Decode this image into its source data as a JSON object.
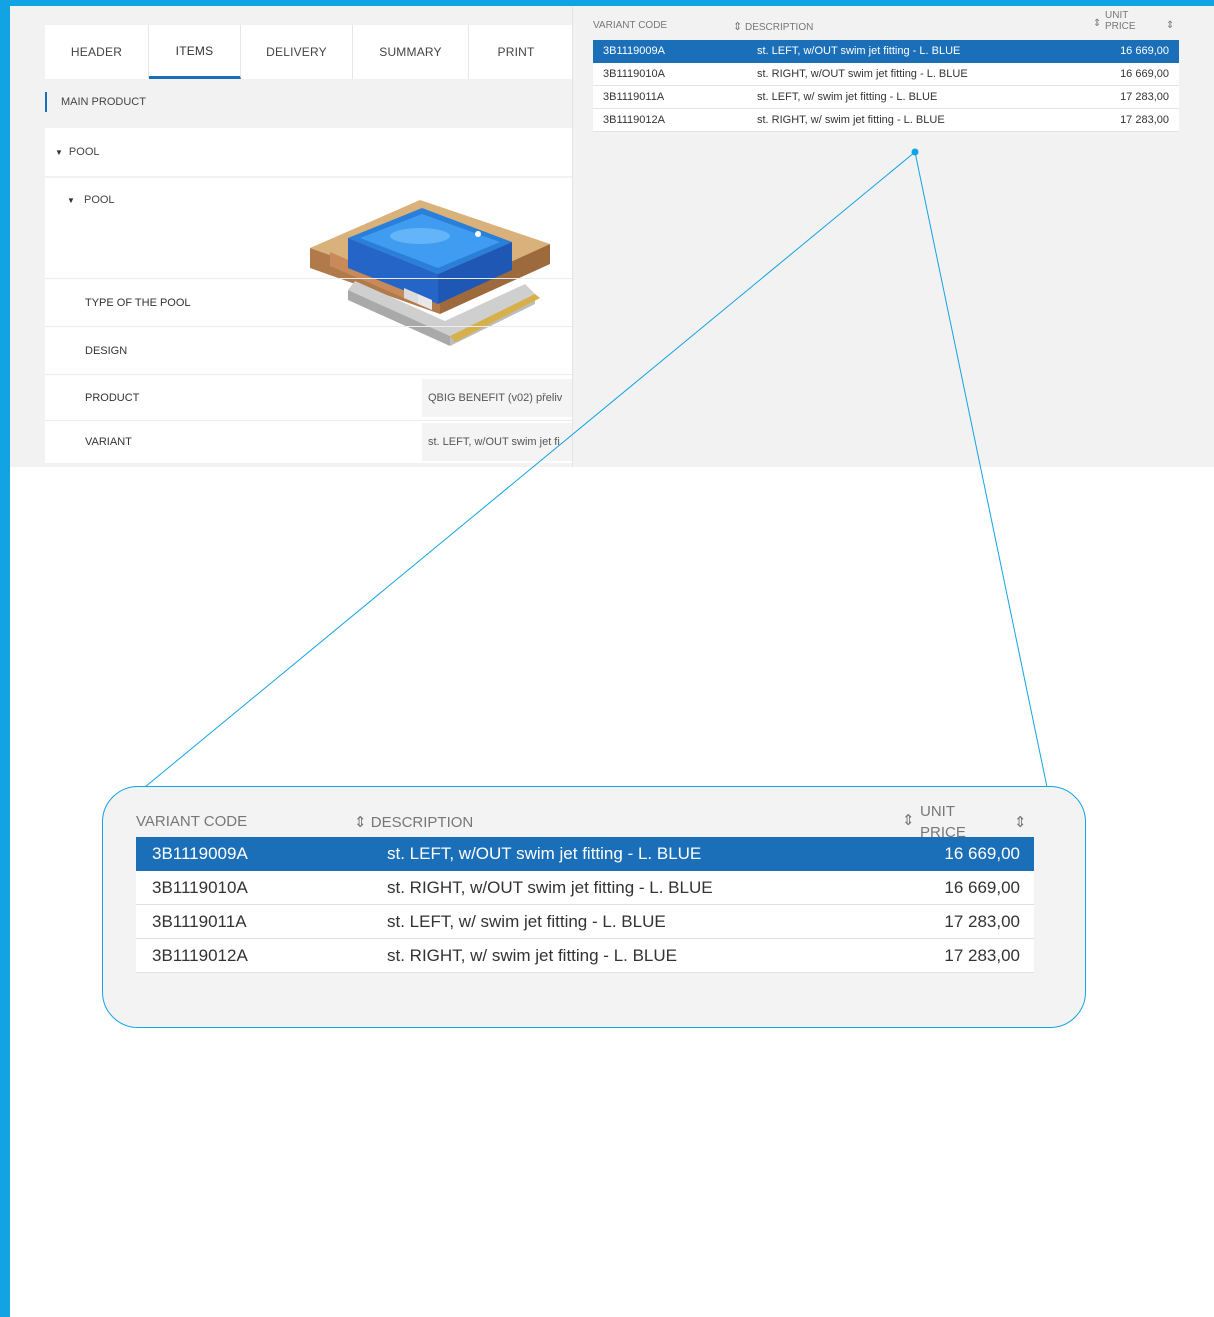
{
  "tabs": [
    {
      "label": "HEADER"
    },
    {
      "label": "ITEMS"
    },
    {
      "label": "DELIVERY"
    },
    {
      "label": "SUMMARY"
    },
    {
      "label": "PRINT"
    }
  ],
  "active_tab": "ITEMS",
  "main_product": {
    "section_label": "MAIN PRODUCT",
    "pool_group_label": "POOL",
    "pool_item_label": "POOL",
    "properties": [
      {
        "label": "TYPE OF THE POOL",
        "value": ""
      },
      {
        "label": "DESIGN",
        "value": ""
      },
      {
        "label": "PRODUCT",
        "value": "QBIG BENEFIT (v02) přeliv"
      },
      {
        "label": "VARIANT",
        "value": "st. LEFT, w/OUT swim jet fi"
      }
    ]
  },
  "variant_table": {
    "columns": {
      "code": "VARIANT CODE",
      "description": "DESCRIPTION",
      "price_line1": "UNIT",
      "price_line2": "PRICE"
    },
    "sort_icon": "⇕",
    "rows": [
      {
        "code": "3B1119009A",
        "description": "st. LEFT, w/OUT swim jet fitting - L. BLUE",
        "price": "16 669,00",
        "selected": true
      },
      {
        "code": "3B1119010A",
        "description": "st. RIGHT, w/OUT swim jet fitting - L. BLUE",
        "price": "16 669,00",
        "selected": false
      },
      {
        "code": "3B1119011A",
        "description": "st. LEFT, w/ swim jet fitting - L. BLUE",
        "price": "17 283,00",
        "selected": false
      },
      {
        "code": "3B1119012A",
        "description": "st. RIGHT, w/ swim jet fitting - L. BLUE",
        "price": "17 283,00",
        "selected": false
      }
    ]
  },
  "colors": {
    "accent": "#12a3e3",
    "selection": "#1b6fb8",
    "panel_bg": "#f2f2f2"
  },
  "icons": {
    "caret": "caret-down-icon",
    "sort": "sort-icon",
    "pool_image": "pool-illustration"
  }
}
